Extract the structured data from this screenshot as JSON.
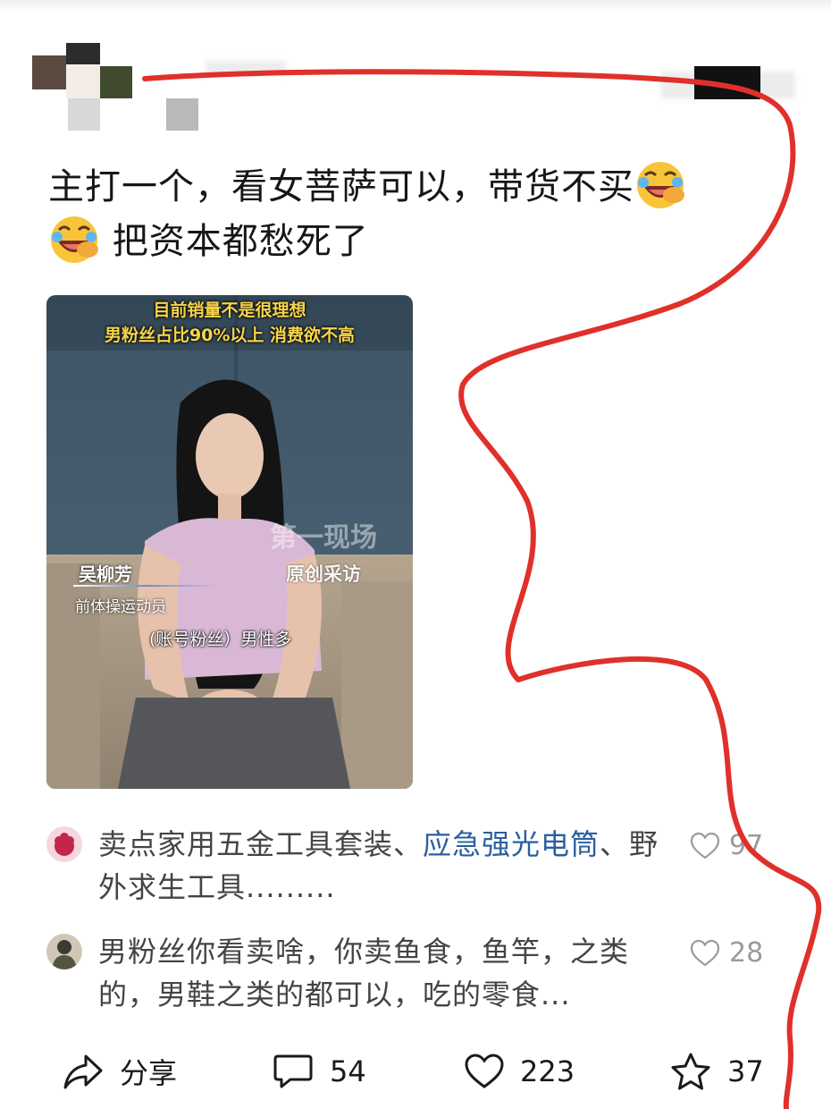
{
  "post": {
    "line1": "主打一个，看女菩萨可以，带货不买",
    "line2": "把资本都愁死了",
    "emoji": "rofl-emoji"
  },
  "video": {
    "caption_top_1": "目前销量不是很理想",
    "caption_top_2": "男粉丝占比90%以上 消费欲不高",
    "watermark": "第一现场",
    "tag": "原创采访",
    "person_name": "吴柳芳",
    "person_title": "前体操运动员",
    "subtitle": "(账号粉丝）男性多"
  },
  "comments": [
    {
      "text_before": "卖点家用五金工具套装、",
      "link": "应急强光电筒",
      "text_after": "、野外求生工具.........",
      "likes": "97"
    },
    {
      "text": "男粉丝你看卖啥，你卖鱼食，鱼竿，之类的，男鞋之类的都可以，吃的零食...",
      "likes": "28"
    }
  ],
  "actions": {
    "share_label": "分享",
    "comments_count": "54",
    "likes_count": "223",
    "favorites_count": "37"
  },
  "colors": {
    "annotation_line": "#e0302a",
    "link": "#2b5f9e",
    "caption_yellow": "#f7d54a"
  }
}
